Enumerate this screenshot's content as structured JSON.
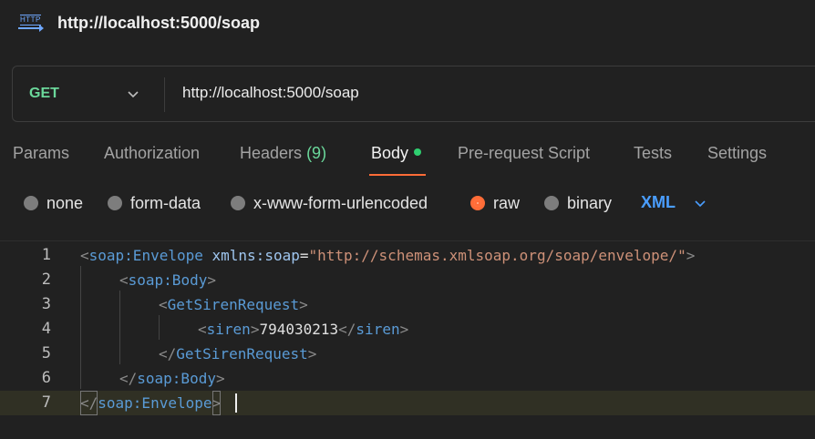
{
  "header": {
    "icon": "http-icon",
    "icon_text": "HTTP",
    "title": "http://localhost:5000/soap"
  },
  "urlbar": {
    "method": "GET",
    "url": "http://localhost:5000/soap"
  },
  "tabs": [
    {
      "label": "Params"
    },
    {
      "label": "Authorization"
    },
    {
      "label": "Headers",
      "count": "(9)"
    },
    {
      "label": "Body",
      "active": true
    },
    {
      "label": "Pre-request Script"
    },
    {
      "label": "Tests"
    },
    {
      "label": "Settings"
    }
  ],
  "body_options": [
    {
      "label": "none"
    },
    {
      "label": "form-data"
    },
    {
      "label": "x-www-form-urlencoded"
    },
    {
      "label": "raw",
      "selected": true
    },
    {
      "label": "binary"
    }
  ],
  "language": "XML",
  "editor": {
    "line_numbers": [
      "1",
      "2",
      "3",
      "4",
      "5",
      "6",
      "7"
    ],
    "lines": [
      {
        "open": "<",
        "tag": "soap:Envelope",
        "attr": "xmlns:soap",
        "eq": "=",
        "value": "\"http://schemas.xmlsoap.org/soap/envelope/\"",
        "close": ">"
      },
      {
        "open": "<",
        "tag": "soap:Body",
        "close": ">"
      },
      {
        "open": "<",
        "tag": "GetSirenRequest",
        "close": ">"
      },
      {
        "open": "<",
        "tag": "siren",
        "close": ">",
        "text": "794030213",
        "end_open": "</",
        "end_tag": "siren",
        "end_close": ">"
      },
      {
        "open": "</",
        "tag": "GetSirenRequest",
        "close": ">"
      },
      {
        "open": "</",
        "tag": "soap:Body",
        "close": ">"
      },
      {
        "open": "</",
        "tag": "soap:Envelope",
        "close": ">"
      }
    ]
  },
  "colors": {
    "method": "#6bd89b",
    "accent": "#ff6c37",
    "link": "#4a9eff",
    "tag": "#5a9bd6",
    "string": "#ce9178"
  }
}
